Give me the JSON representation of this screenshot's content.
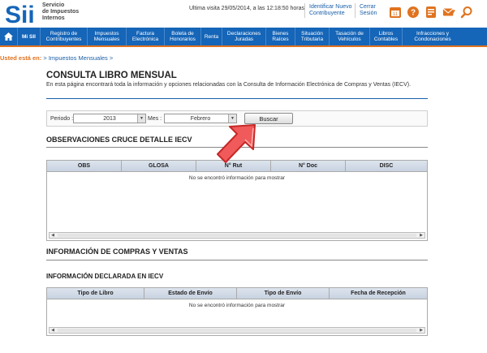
{
  "header": {
    "logo_line1": "Servicio",
    "logo_line2": "de Impuestos",
    "logo_line3": "Internos",
    "last_visit": "Ultima visita 29/05/2014, a las 12:18:50 horas",
    "identify_line1": "Identificar Nuevo",
    "identify_line2": "Contribuyente",
    "logout_line1": "Cerrar",
    "logout_line2": "Sesión",
    "icons": [
      "calendar-icon",
      "help-icon",
      "contact-icon",
      "mail-icon",
      "search-icon"
    ],
    "calendar_day": "11"
  },
  "nav": {
    "mi_sii": "Mi SII",
    "items": [
      {
        "line1": "Registro de",
        "line2": "Contribuyentes"
      },
      {
        "line1": "Impuestos",
        "line2": "Mensuales"
      },
      {
        "line1": "Factura",
        "line2": "Electrónica"
      },
      {
        "line1": "Boleta de",
        "line2": "Honorarios"
      },
      {
        "line1": "Renta",
        "line2": ""
      },
      {
        "line1": "Declaraciones",
        "line2": "Juradas"
      },
      {
        "line1": "Bienes",
        "line2": "Raíces"
      },
      {
        "line1": "Situación",
        "line2": "Tributaria"
      },
      {
        "line1": "Tasación de",
        "line2": "Vehículos"
      },
      {
        "line1": "Libros",
        "line2": "Contables"
      },
      {
        "line1": "Infracciones y",
        "line2": "Condonaciones"
      }
    ]
  },
  "breadcrumb": {
    "label": "Usted está en:",
    "link": "> Impuestos Mensuales  >"
  },
  "page": {
    "title": "CONSULTA LIBRO MENSUAL",
    "description": "En esta página encontrará toda la información y opciones relacionadas con la Consulta de Información Electrónica de Compras y Ventas (IECV)."
  },
  "filters": {
    "period_label": "Periodo :",
    "period_value": "2013",
    "month_label": "Mes :",
    "month_value": "Febrero",
    "search_button": "Buscar"
  },
  "observations": {
    "title": "OBSERVACIONES CRUCE DETALLE IECV",
    "columns": [
      "OBS",
      "GLOSA",
      "N° Rut",
      "N° Doc",
      "DISC"
    ],
    "empty_message": "No se encontró información para mostrar"
  },
  "compras_ventas": {
    "title": "INFORMACIÓN DE COMPRAS Y VENTAS"
  },
  "declared": {
    "title": "INFORMACIÓN DECLARADA EN IECV",
    "columns": [
      "Tipo de Libro",
      "Estado de Envío",
      "Tipo de Envío",
      "Fecha de Recepción"
    ],
    "empty_message": "No se encontró información para mostrar"
  },
  "colors": {
    "nav_blue": "#1565b8",
    "accent_orange": "#e0731f",
    "arrow_red": "#e53935"
  }
}
